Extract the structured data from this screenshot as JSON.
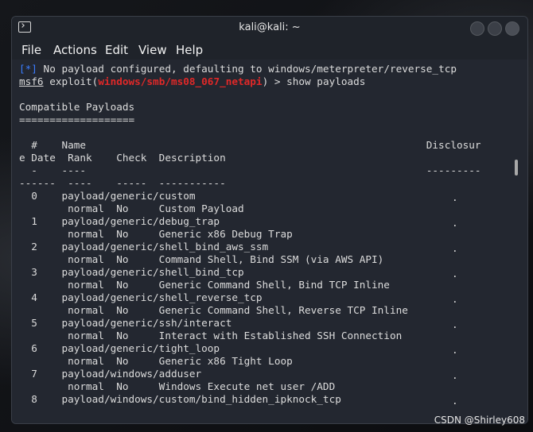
{
  "window": {
    "title": "kali@kali: ~",
    "menu": [
      "File",
      "Actions",
      "Edit",
      "View",
      "Help"
    ]
  },
  "terminal": {
    "info_prefix": "[*]",
    "info_text": " No payload configured, defaulting to windows/meterpreter/reverse_tcp",
    "prompt_msf": "msf6",
    "prompt_mid": " exploit(",
    "prompt_module": "windows/smb/ms08_067_netapi",
    "prompt_end": ") > show payloads",
    "heading": "Compatible Payloads",
    "heading_rule": "===================",
    "columns_line1": "  #    Name                                                        Disclosur",
    "columns_line2": "e Date  Rank    Check  Description",
    "columns_line3": "  -    ----                                                        ---------",
    "columns_line4": "------  ----    -----  -----------",
    "rows": [
      {
        "main": "  0    payload/generic/custom",
        "dot": ".",
        "detail": "        normal  No     Custom Payload"
      },
      {
        "main": "  1    payload/generic/debug_trap",
        "dot": ".",
        "detail": "        normal  No     Generic x86 Debug Trap"
      },
      {
        "main": "  2    payload/generic/shell_bind_aws_ssm",
        "dot": ".",
        "detail": "        normal  No     Command Shell, Bind SSM (via AWS API)"
      },
      {
        "main": "  3    payload/generic/shell_bind_tcp",
        "dot": ".",
        "detail": "        normal  No     Generic Command Shell, Bind TCP Inline"
      },
      {
        "main": "  4    payload/generic/shell_reverse_tcp",
        "dot": ".",
        "detail": "        normal  No     Generic Command Shell, Reverse TCP Inline"
      },
      {
        "main": "  5    payload/generic/ssh/interact",
        "dot": ".",
        "detail": "        normal  No     Interact with Established SSH Connection"
      },
      {
        "main": "  6    payload/generic/tight_loop",
        "dot": ".",
        "detail": "        normal  No     Generic x86 Tight Loop"
      },
      {
        "main": "  7    payload/windows/adduser",
        "dot": ".",
        "detail": "        normal  No     Windows Execute net user /ADD"
      },
      {
        "main": "  8    payload/windows/custom/bind_hidden_ipknock_tcp",
        "dot": ".",
        "detail": ""
      }
    ]
  },
  "watermark": "CSDN @Shirley608"
}
